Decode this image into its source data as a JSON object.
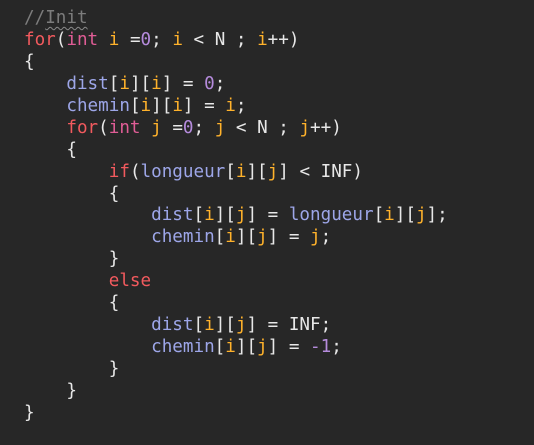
{
  "editor": {
    "colors": {
      "background": "#272727",
      "comment": "#7c7c7c",
      "keyword": "#f25a5e",
      "type": "#e05d96",
      "identifier": "#9da6e8",
      "variable": "#ffb22b",
      "number": "#b58bdc",
      "plain": "#e8e8e8"
    },
    "lines": [
      [
        [
          "comment",
          "//"
        ],
        [
          "comment-underline",
          "Init"
        ]
      ],
      [
        [
          "keyword",
          "for"
        ],
        [
          "punct",
          "("
        ],
        [
          "type",
          "int"
        ],
        [
          "ws",
          " "
        ],
        [
          "var",
          "i"
        ],
        [
          "ws",
          " "
        ],
        [
          "op",
          "="
        ],
        [
          "number",
          "0"
        ],
        [
          "punct",
          ";"
        ],
        [
          "ws",
          " "
        ],
        [
          "var",
          "i"
        ],
        [
          "ws",
          " "
        ],
        [
          "op",
          "<"
        ],
        [
          "ws",
          " "
        ],
        [
          "const",
          "N"
        ],
        [
          "ws",
          " "
        ],
        [
          "punct",
          ";"
        ],
        [
          "ws",
          " "
        ],
        [
          "var",
          "i"
        ],
        [
          "op",
          "++"
        ],
        [
          "punct",
          ")"
        ]
      ],
      [
        [
          "punct",
          "{"
        ]
      ],
      [
        [
          "ws",
          "    "
        ],
        [
          "ident",
          "dist"
        ],
        [
          "punct",
          "["
        ],
        [
          "var",
          "i"
        ],
        [
          "punct",
          "]["
        ],
        [
          "var",
          "i"
        ],
        [
          "punct",
          "]"
        ],
        [
          "ws",
          " "
        ],
        [
          "op",
          "="
        ],
        [
          "ws",
          " "
        ],
        [
          "number",
          "0"
        ],
        [
          "punct",
          ";"
        ]
      ],
      [
        [
          "ws",
          "    "
        ],
        [
          "ident",
          "chemin"
        ],
        [
          "punct",
          "["
        ],
        [
          "var",
          "i"
        ],
        [
          "punct",
          "]["
        ],
        [
          "var",
          "i"
        ],
        [
          "punct",
          "]"
        ],
        [
          "ws",
          " "
        ],
        [
          "op",
          "="
        ],
        [
          "ws",
          " "
        ],
        [
          "var",
          "i"
        ],
        [
          "punct",
          ";"
        ]
      ],
      [
        [
          "ws",
          "    "
        ],
        [
          "keyword",
          "for"
        ],
        [
          "punct",
          "("
        ],
        [
          "type",
          "int"
        ],
        [
          "ws",
          " "
        ],
        [
          "var",
          "j"
        ],
        [
          "ws",
          " "
        ],
        [
          "op",
          "="
        ],
        [
          "number",
          "0"
        ],
        [
          "punct",
          ";"
        ],
        [
          "ws",
          " "
        ],
        [
          "var",
          "j"
        ],
        [
          "ws",
          " "
        ],
        [
          "op",
          "<"
        ],
        [
          "ws",
          " "
        ],
        [
          "const",
          "N"
        ],
        [
          "ws",
          " "
        ],
        [
          "punct",
          ";"
        ],
        [
          "ws",
          " "
        ],
        [
          "var",
          "j"
        ],
        [
          "op",
          "++"
        ],
        [
          "punct",
          ")"
        ]
      ],
      [
        [
          "ws",
          "    "
        ],
        [
          "punct",
          "{"
        ]
      ],
      [
        [
          "ws",
          "        "
        ],
        [
          "keyword",
          "if"
        ],
        [
          "punct",
          "("
        ],
        [
          "ident",
          "longueur"
        ],
        [
          "punct",
          "["
        ],
        [
          "var",
          "i"
        ],
        [
          "punct",
          "]["
        ],
        [
          "var",
          "j"
        ],
        [
          "punct",
          "]"
        ],
        [
          "ws",
          " "
        ],
        [
          "op",
          "<"
        ],
        [
          "ws",
          " "
        ],
        [
          "const",
          "INF"
        ],
        [
          "punct",
          ")"
        ]
      ],
      [
        [
          "ws",
          "        "
        ],
        [
          "punct",
          "{"
        ]
      ],
      [
        [
          "ws",
          "            "
        ],
        [
          "ident",
          "dist"
        ],
        [
          "punct",
          "["
        ],
        [
          "var",
          "i"
        ],
        [
          "punct",
          "]["
        ],
        [
          "var",
          "j"
        ],
        [
          "punct",
          "]"
        ],
        [
          "ws",
          " "
        ],
        [
          "op",
          "="
        ],
        [
          "ws",
          " "
        ],
        [
          "ident",
          "longueur"
        ],
        [
          "punct",
          "["
        ],
        [
          "var",
          "i"
        ],
        [
          "punct",
          "]["
        ],
        [
          "var",
          "j"
        ],
        [
          "punct",
          "];"
        ]
      ],
      [
        [
          "ws",
          "            "
        ],
        [
          "ident",
          "chemin"
        ],
        [
          "punct",
          "["
        ],
        [
          "var",
          "i"
        ],
        [
          "punct",
          "]["
        ],
        [
          "var",
          "j"
        ],
        [
          "punct",
          "]"
        ],
        [
          "ws",
          " "
        ],
        [
          "op",
          "="
        ],
        [
          "ws",
          " "
        ],
        [
          "var",
          "j"
        ],
        [
          "punct",
          ";"
        ]
      ],
      [
        [
          "ws",
          "        "
        ],
        [
          "punct",
          "}"
        ]
      ],
      [
        [
          "ws",
          "        "
        ],
        [
          "keyword",
          "else"
        ]
      ],
      [
        [
          "ws",
          "        "
        ],
        [
          "punct",
          "{"
        ]
      ],
      [
        [
          "ws",
          "            "
        ],
        [
          "ident",
          "dist"
        ],
        [
          "punct",
          "["
        ],
        [
          "var",
          "i"
        ],
        [
          "punct",
          "]["
        ],
        [
          "var",
          "j"
        ],
        [
          "punct",
          "]"
        ],
        [
          "ws",
          " "
        ],
        [
          "op",
          "="
        ],
        [
          "ws",
          " "
        ],
        [
          "const",
          "INF"
        ],
        [
          "punct",
          ";"
        ]
      ],
      [
        [
          "ws",
          "            "
        ],
        [
          "ident",
          "chemin"
        ],
        [
          "punct",
          "["
        ],
        [
          "var",
          "i"
        ],
        [
          "punct",
          "]["
        ],
        [
          "var",
          "j"
        ],
        [
          "punct",
          "]"
        ],
        [
          "ws",
          " "
        ],
        [
          "op",
          "="
        ],
        [
          "ws",
          " "
        ],
        [
          "number",
          "-1"
        ],
        [
          "punct",
          ";"
        ]
      ],
      [
        [
          "ws",
          "        "
        ],
        [
          "punct",
          "}"
        ]
      ],
      [
        [
          "ws",
          "    "
        ],
        [
          "punct",
          "}"
        ]
      ],
      [
        [
          "punct",
          "}"
        ]
      ]
    ]
  }
}
